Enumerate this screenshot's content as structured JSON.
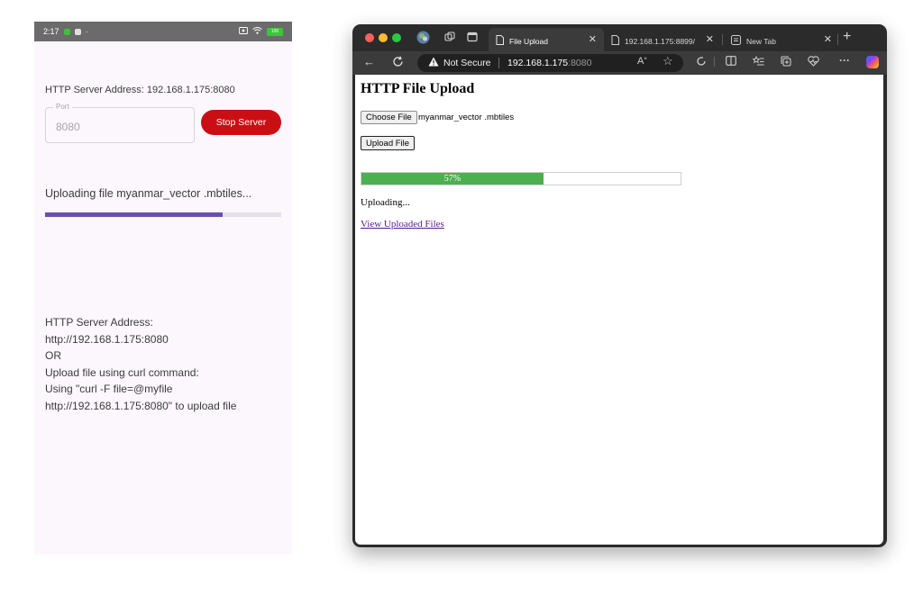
{
  "phone": {
    "status_time": "2:17",
    "status_dot": "·",
    "battery": "100",
    "server_address_line": "HTTP Server Address: 192.168.1.175:8080",
    "port_label": "Port",
    "port_value": "8080",
    "stop_button": "Stop Server",
    "uploading_text": "Uploading file myanmar_vector .mbtiles...",
    "progress_fraction": 0.75,
    "info_lines": [
      "HTTP Server Address:",
      "http://192.168.1.175:8080",
      "OR",
      "Upload file using curl command:",
      "Using \"curl -F file=@myfile",
      "http://192.168.1.175:8080\" to upload file"
    ],
    "colors": {
      "accent": "#6b4fad",
      "stop_button": "#c90f14",
      "background": "#fcf7fd"
    }
  },
  "browser": {
    "tabs": [
      {
        "label": "File Upload",
        "active": true,
        "icon": "page-icon"
      },
      {
        "label": "192.168.1.175:8899/",
        "active": false,
        "icon": "page-icon"
      },
      {
        "label": "New Tab",
        "active": false,
        "icon": "newtab-icon"
      }
    ],
    "address": {
      "security_label": "Not Secure",
      "host": "192.168.1.175",
      "port": ":8080"
    },
    "page": {
      "heading": "HTTP File Upload",
      "choose_button": "Choose File",
      "file_name": "myanmar_vector .mbtiles",
      "upload_button": "Upload File",
      "progress_text": "57%",
      "progress_fraction": 0.57,
      "status": "Uploading...",
      "link": "View Uploaded Files"
    },
    "colors": {
      "progress": "#4caf50",
      "link": "#551a8b",
      "chrome": "#3b3b3b"
    }
  }
}
